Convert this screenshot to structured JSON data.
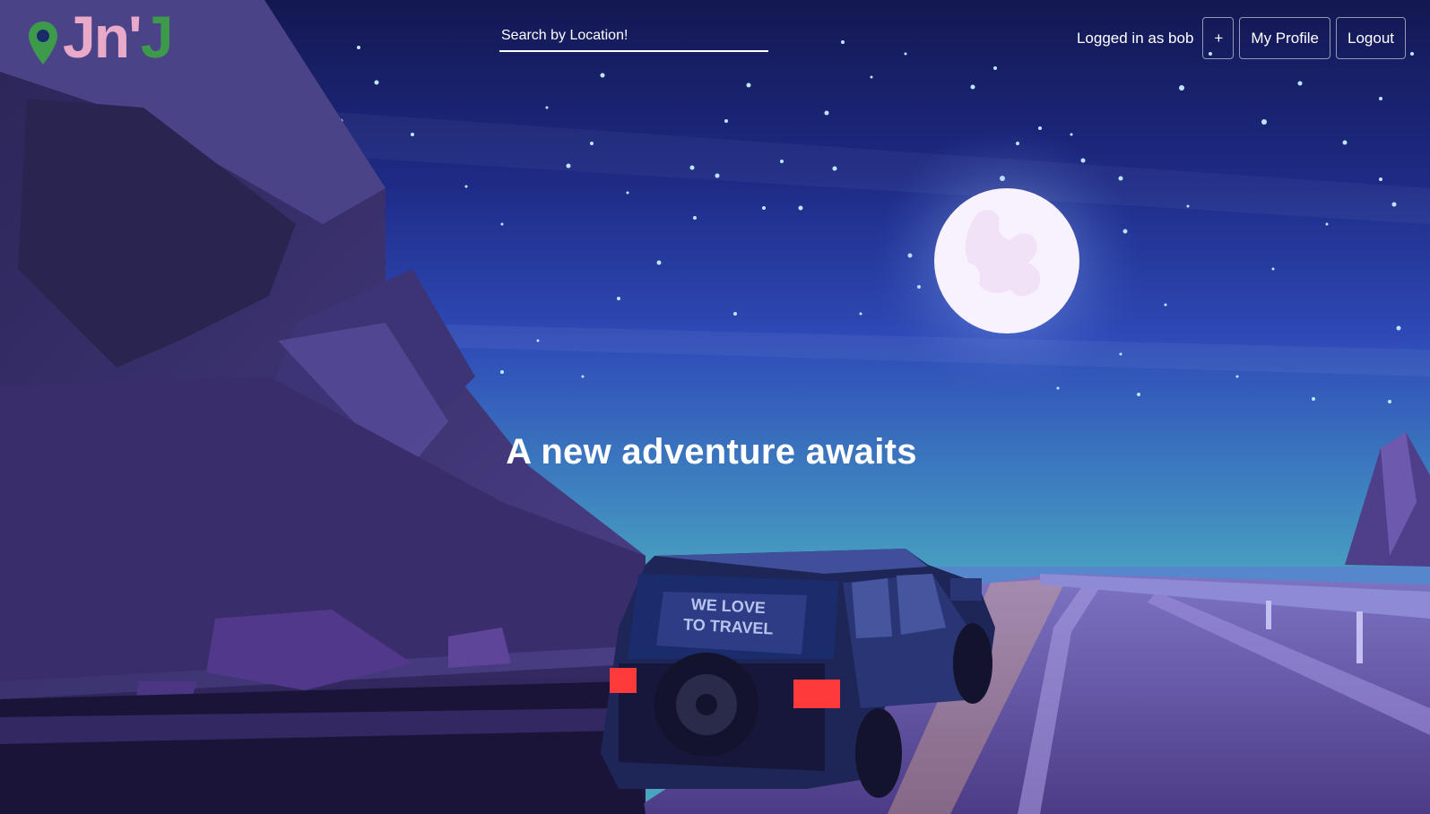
{
  "brand": {
    "logo_text_part1": "Jn",
    "logo_text_apostrophe": "'",
    "logo_text_part2": "J",
    "pink": "#e9a9c8",
    "green": "#3e9a4b"
  },
  "search": {
    "placeholder": "Search by Location!",
    "value": ""
  },
  "user": {
    "logged_in_text": "Logged in as bob"
  },
  "nav": {
    "add_label": "+",
    "profile_label": "My Profile",
    "logout_label": "Logout"
  },
  "hero": {
    "title": "A new adventure awaits",
    "bumper_sticker_line1": "WE LOVE",
    "bumper_sticker_line2": "TO TRAVEL"
  },
  "colors": {
    "sky_top": "#151a55",
    "sky_mid": "#2d49b8",
    "sky_horizon": "#47a0c2",
    "moon": "#f8f2ff",
    "rock": "#3a3567",
    "road": "#6b5ca6"
  }
}
